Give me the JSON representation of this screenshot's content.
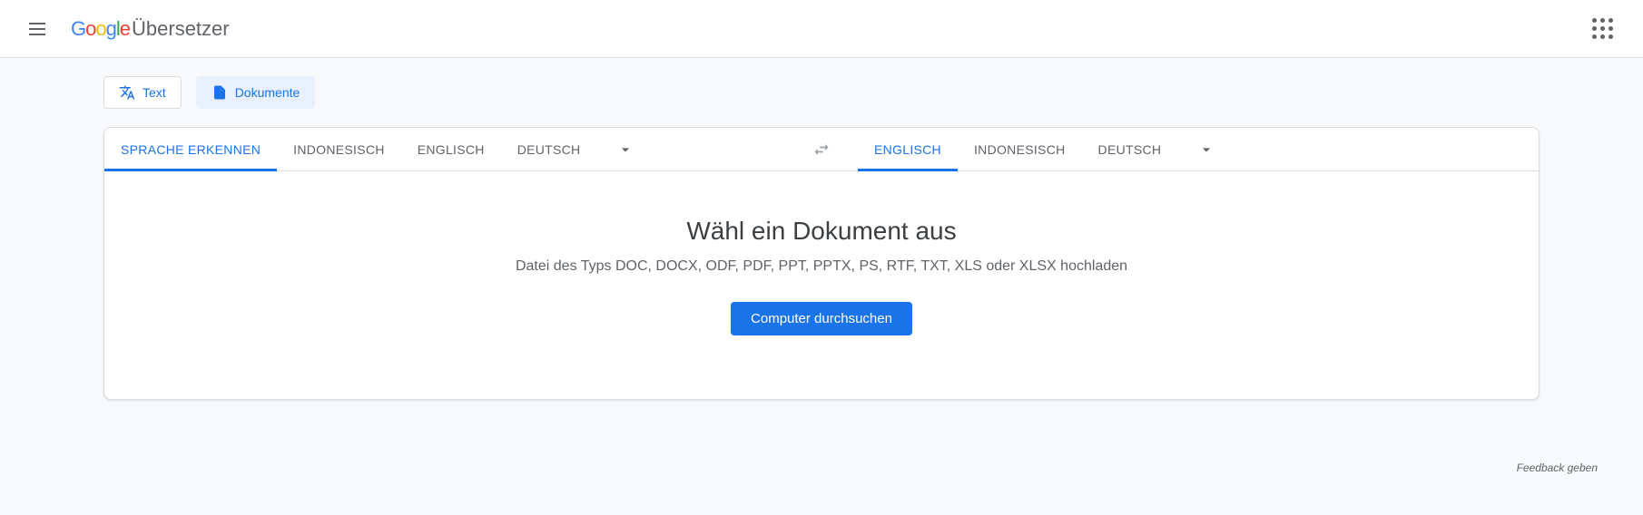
{
  "header": {
    "app_name": "Übersetzer"
  },
  "tabs": {
    "text": "Text",
    "documents": "Dokumente"
  },
  "source_langs": {
    "detect": "SPRACHE ERKENNEN",
    "l1": "INDONESISCH",
    "l2": "ENGLISCH",
    "l3": "DEUTSCH"
  },
  "target_langs": {
    "l1": "ENGLISCH",
    "l2": "INDONESISCH",
    "l3": "DEUTSCH"
  },
  "upload": {
    "title": "Wähl ein Dokument aus",
    "subtitle": "Datei des Typs DOC, DOCX, ODF, PDF, PPT, PPTX, PS, RTF, TXT, XLS oder XLSX hochladen",
    "button": "Computer durchsuchen"
  },
  "footer": {
    "feedback": "Feedback geben"
  }
}
